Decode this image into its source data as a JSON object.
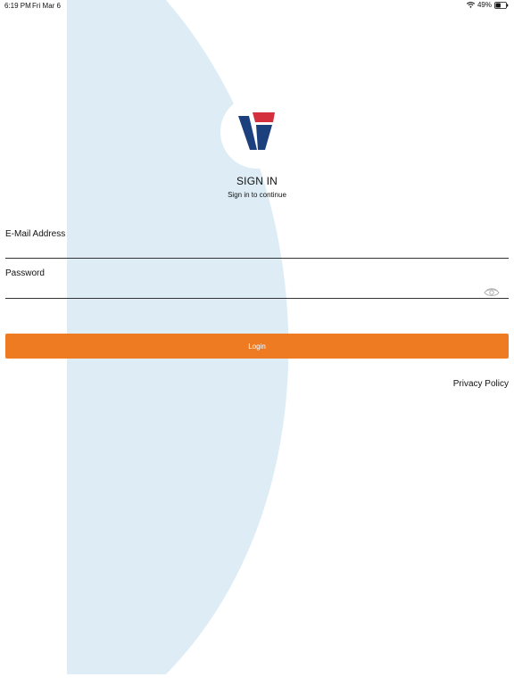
{
  "status_bar": {
    "time": "6:19 PM",
    "date": "Fri Mar 6",
    "battery": "49%",
    "battery_level": 0.49
  },
  "colors": {
    "accent": "#ee7a22",
    "background_shape": "#deedf5",
    "logo_red": "#d32f3c",
    "logo_blue": "#1c3f7d"
  },
  "logo": {
    "icon": "brand-v-logo"
  },
  "header": {
    "title": "SIGN IN",
    "subtitle": "Sign in to continue"
  },
  "form": {
    "email_label": "E-Mail Address",
    "email_value": "",
    "password_label": "Password",
    "password_value": "",
    "password_toggle_icon": "eye-icon",
    "login_label": "Login"
  },
  "footer": {
    "privacy_label": "Privacy Policy"
  }
}
